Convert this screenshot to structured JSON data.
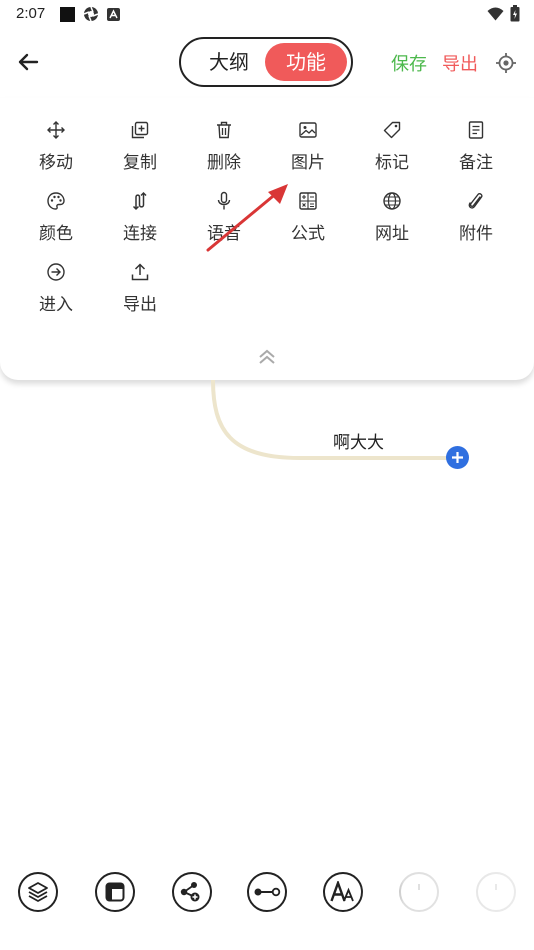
{
  "status_bar": {
    "time": "2:07",
    "icons": [
      "square-icon",
      "aperture-icon",
      "font-a-icon",
      "wifi-icon",
      "battery-icon"
    ]
  },
  "header": {
    "back_icon": "arrow-left-icon",
    "toggle": {
      "left_label": "大纲",
      "right_label": "功能",
      "active": "功能"
    },
    "save_label": "保存",
    "export_label": "导出",
    "locate_icon": "target-icon"
  },
  "colors": {
    "accent_red": "#f05a5a",
    "save_green": "#4cb84c",
    "node_blue": "#2f6fe0",
    "branch": "#ede5cc"
  },
  "tools": [
    {
      "label": "移动",
      "icon": "move-icon"
    },
    {
      "label": "复制",
      "icon": "copy-icon"
    },
    {
      "label": "删除",
      "icon": "trash-icon"
    },
    {
      "label": "图片",
      "icon": "image-icon"
    },
    {
      "label": "标记",
      "icon": "tag-icon"
    },
    {
      "label": "备注",
      "icon": "note-icon"
    },
    {
      "label": "颜色",
      "icon": "palette-icon"
    },
    {
      "label": "连接",
      "icon": "link-icon"
    },
    {
      "label": "语音",
      "icon": "mic-icon"
    },
    {
      "label": "公式",
      "icon": "formula-icon"
    },
    {
      "label": "网址",
      "icon": "globe-icon"
    },
    {
      "label": "附件",
      "icon": "paperclip-icon"
    },
    {
      "label": "进入",
      "icon": "enter-icon"
    },
    {
      "label": "导出",
      "icon": "upload-icon"
    }
  ],
  "canvas": {
    "node_text": "啊大大"
  },
  "bottom_toolbar": [
    "layers-icon",
    "layout-icon",
    "structure-icon",
    "connector-icon",
    "font-icon",
    "more-icon",
    "more-icon-2"
  ]
}
